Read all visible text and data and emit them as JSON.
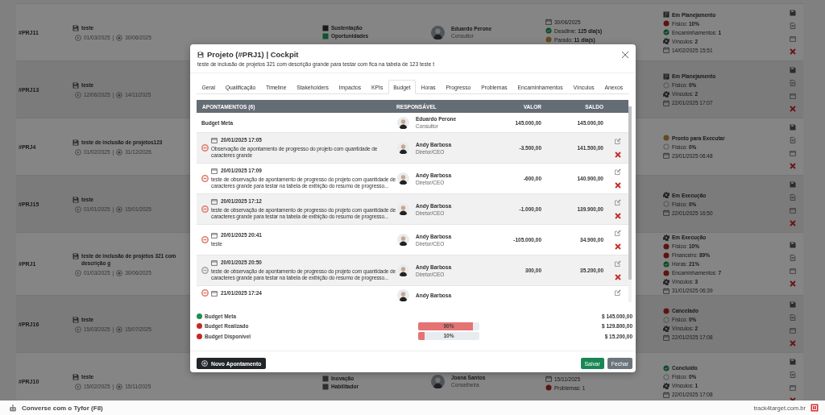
{
  "projects": [
    {
      "id": "#PRJ11",
      "title": "teste",
      "start": "01/03/2025",
      "sep": "|",
      "end": "30/06/2025",
      "categories": [
        {
          "label": "Sustentação",
          "color": "#171b1c"
        },
        {
          "label": "Oportunidades",
          "color": "#10522f"
        }
      ],
      "person": {
        "name": "Eduardo Perone",
        "role": "Consultor"
      },
      "deadline": [
        {
          "kind": "date",
          "text": "30/06/2025"
        },
        {
          "kind": "check",
          "color": "#0f4a29",
          "text": "Deadline: **125 dia(s)**"
        },
        {
          "kind": "dot",
          "color": "#664820",
          "text": "Parado: **11 dia(s)**"
        }
      ],
      "statuses": [
        {
          "kind": "square",
          "text": "Em Planejamento"
        },
        {
          "kind": "dot",
          "color": "#5d1410",
          "text": "Físico: **10%**"
        },
        {
          "kind": "check",
          "color": "#0f4a29",
          "text": "Encaminhamentos: **1**"
        },
        {
          "kind": "gear",
          "text": "Vínculos: **2**"
        },
        {
          "kind": "date",
          "text": "14/02/2025 15:51"
        }
      ]
    },
    {
      "id": "#PRJ13",
      "title": "teste",
      "start": "12/06/2025",
      "sep": "|",
      "end": "14/11/2025",
      "statuses": [
        {
          "kind": "square",
          "text": "Em Planejamento"
        },
        {
          "kind": "empty",
          "text": "Físico: **0%**"
        },
        {
          "kind": "gear",
          "text": "Vínculos: **2**"
        },
        {
          "kind": "date",
          "text": "22/01/2025 17:07"
        }
      ]
    },
    {
      "id": "#PRJ4",
      "title": "teste de inclusão de projetos123",
      "start": "01/02/2025",
      "sep": "|",
      "end": "31/12/2026",
      "statuses": [
        {
          "kind": "dot",
          "color": "#664820",
          "text": "Pronto para Executar"
        },
        {
          "kind": "empty",
          "text": "Físico: **0%**"
        },
        {
          "kind": "date",
          "text": "23/01/2025 06:48"
        }
      ]
    },
    {
      "id": "#PRJ15",
      "title": "teste",
      "start": "01/01/2025",
      "sep": "|",
      "end": "15/01/2025",
      "statuses": [
        {
          "kind": "gear",
          "text": "Em Execução"
        },
        {
          "kind": "empty",
          "text": "Físico: **0%**"
        },
        {
          "kind": "date",
          "text": "22/01/2025 16:50"
        }
      ]
    },
    {
      "id": "#PRJ1",
      "title": "teste de inclusão de projetos 321 com descrição g",
      "start": "01/03/2025",
      "sep": "|",
      "end": "30/06/2025",
      "statuses": [
        {
          "kind": "gear",
          "text": "Em Execução"
        },
        {
          "kind": "dot",
          "color": "#5d1410",
          "text": "Físico: **10%**"
        },
        {
          "kind": "dot",
          "color": "#5d1410",
          "text": "Financeiro: **89%**"
        },
        {
          "kind": "check",
          "color": "#0f4a29",
          "text": "Horas: **21%**"
        },
        {
          "kind": "dot",
          "color": "#5d1410",
          "text": "Encaminhamentos: **7**"
        },
        {
          "kind": "gear",
          "text": "Vínculos: **3**"
        },
        {
          "kind": "date",
          "text": "31/01/2025 06:39"
        }
      ]
    },
    {
      "id": "#PRJ16",
      "title": "teste",
      "start": "15/03/2025",
      "sep": "|",
      "end": "15/07/2025",
      "statuses": [
        {
          "kind": "dot",
          "color": "#5d1410",
          "text": "Cancelado"
        },
        {
          "kind": "empty",
          "text": "Físico: **0%**"
        },
        {
          "kind": "gear",
          "text": "Vínculos: **2**"
        },
        {
          "kind": "date",
          "text": "22/01/2025 17:08"
        }
      ]
    },
    {
      "id": "#PRJ10",
      "title": "teste",
      "start": "15/02/2025",
      "sep": "|",
      "end": "15/11/2025",
      "categories": [
        {
          "label": "Inovação",
          "color": "#2c2f32"
        },
        {
          "label": "Habilitador",
          "color": "#2c2f32"
        }
      ],
      "person": {
        "name": "Joana Santos",
        "role": "Conselheira"
      },
      "deadline": [
        {
          "kind": "date",
          "text": "15/11/2025"
        },
        {
          "kind": "dot",
          "color": "#5d1410",
          "text": "Problemas: 1"
        }
      ],
      "statuses": [
        {
          "kind": "check",
          "color": "#0f4a29",
          "text": "Concluído"
        },
        {
          "kind": "empty",
          "text": "Físico: **0%**"
        },
        {
          "kind": "gear",
          "text": "Vínculos: **1**"
        },
        {
          "kind": "date",
          "text": "22/01/2025 17:08"
        }
      ]
    }
  ],
  "modal": {
    "title": "Projeto (#PRJ1) | Cockpit",
    "subtitle": "teste de inclusão de projetos 321 com descrição grande para testar com fica na tabela de 123 teste t",
    "tabs": [
      {
        "label": "Geral",
        "selected": false
      },
      {
        "label": "Qualificação",
        "selected": false
      },
      {
        "label": "Timeline",
        "selected": false
      },
      {
        "label": "Stakeholders",
        "selected": false
      },
      {
        "label": "Impactos",
        "selected": false
      },
      {
        "label": "KPIs",
        "selected": false
      },
      {
        "label": "Budget",
        "selected": true
      },
      {
        "label": "Horas",
        "selected": false
      },
      {
        "label": "Progresso",
        "selected": false
      },
      {
        "label": "Problemas",
        "selected": false
      },
      {
        "label": "Encaminhamentos",
        "selected": false
      },
      {
        "label": "Vínculos",
        "selected": false
      },
      {
        "label": "Anexos",
        "selected": false
      }
    ],
    "columns": [
      "APONTAMENTOS (6)",
      "RESPONSÁVEL",
      "VALOR",
      "SALDO"
    ],
    "rows": [
      {
        "kind": "meta",
        "label": "Budget Meta",
        "person": "Eduardo Perone",
        "role": "Consultor",
        "value": "145.000,00",
        "balance": "145.000,00"
      },
      {
        "kind": "entry",
        "color": "#e07a6a",
        "date": "20/01/2025 17:05",
        "note": "Observação de apontamento de progresso do projeto com quantidade de caracteres grande",
        "person": "Andy Barbosa",
        "role": "Diretor/CEO",
        "value": "-3.500,00",
        "balance": "141.500,00"
      },
      {
        "kind": "entry",
        "color": "#e07a6a",
        "date": "20/01/2025 17:09",
        "note": "teste de observação de apontamento de progresso do projeto com quantidade de caracteres grande para testar na tabela de exibição do resumo de progresso...",
        "person": "Andy Barbosa",
        "role": "Diretor/CEO",
        "value": "-600,00",
        "balance": "140.900,00"
      },
      {
        "kind": "entry",
        "color": "#e07a6a",
        "date": "20/01/2025 17:12",
        "note": "teste de observação de apontamento de progresso do projeto com quantidade de caracteres grande para testar na tabela de exibição do resumo de progresso...",
        "person": "Andy Barbosa",
        "role": "Diretor/CEO",
        "value": "-1.000,00",
        "balance": "139.900,00"
      },
      {
        "kind": "entry",
        "color": "#e07a6a",
        "date": "20/01/2025 20:41",
        "note": "teste",
        "person": "Andy Barbosa",
        "role": "Diretor/CEO",
        "value": "-105.000,00",
        "balance": "34.900,00"
      },
      {
        "kind": "entry",
        "color": "#a0a4a8",
        "date": "20/01/2025 20:50",
        "note": "teste de observação de apontamento de progresso do projeto com quantidade de caracteres grande para testar na tabela de exibição do resumo de progresso...",
        "person": "Andy Barbosa",
        "role": "Diretor/CEO",
        "value": "300,00",
        "balance": "35.200,00"
      },
      {
        "kind": "entry",
        "color": "#e07a6a",
        "date": "21/01/2025 17:24",
        "person": "Andy Barbosa"
      }
    ],
    "summary": [
      {
        "label": "Budget Meta",
        "color": "#1e8e4e",
        "amount": "$ 145.000,00"
      },
      {
        "label": "Budget Realizado",
        "color": "#c62828",
        "percent": "90%",
        "level": 0.9,
        "amount": "$ 129.800,00"
      },
      {
        "label": "Budget Disponível",
        "color": "#c62828",
        "percent": "10%",
        "level": 0.1,
        "amount": "$ 15.200,00"
      }
    ],
    "buttons": {
      "add": "Novo Apontamento",
      "save": "Salvar",
      "close": "Fechar"
    }
  },
  "bottom_bar": {
    "chat": "Converse com o Tyfor (F8)",
    "site": "track4target.com.br"
  }
}
